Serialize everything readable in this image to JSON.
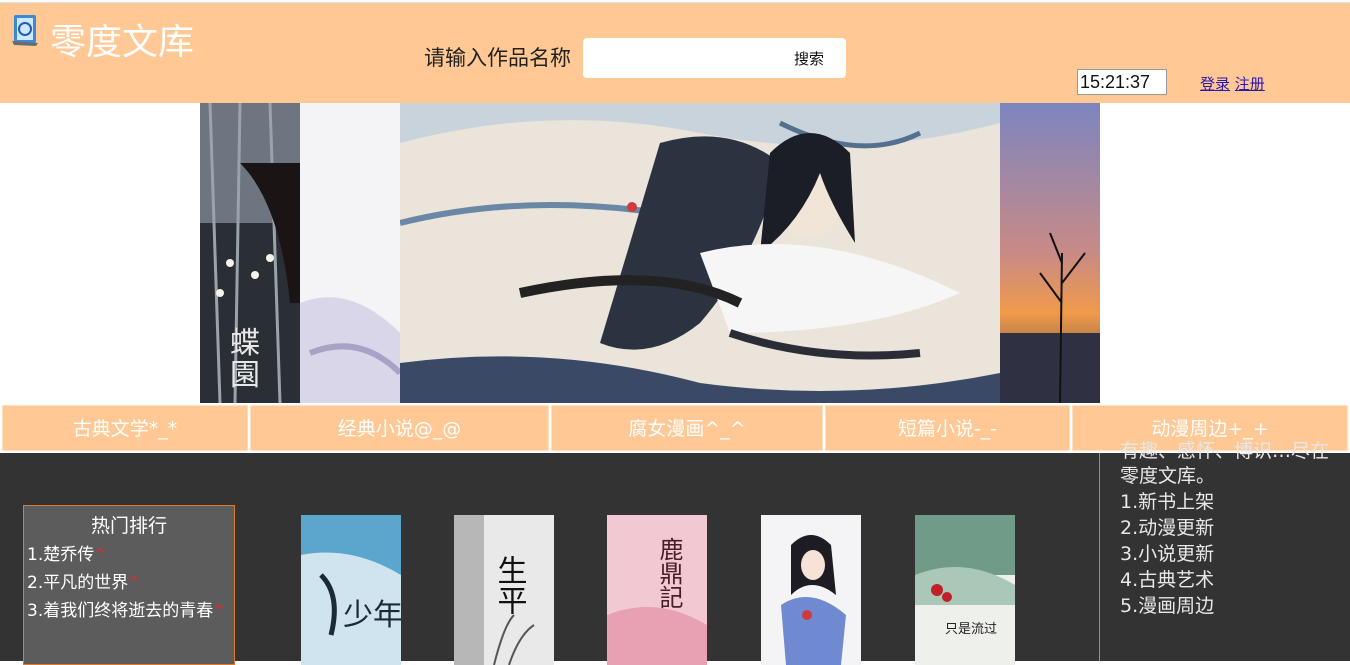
{
  "header": {
    "site_title": "零度文库",
    "search_label": "请输入作品名称",
    "search_placeholder": "",
    "search_button": "搜索",
    "clock": "15:21:37",
    "login": "登录",
    "register": "注册"
  },
  "nav": {
    "items": [
      "古典文学*_*",
      "经典小说@_@",
      "腐女漫画^_^",
      "短篇小说-_-",
      "动漫周边+_+"
    ]
  },
  "hot": {
    "title": "热门排行",
    "items": [
      "1.楚乔传",
      "2.平凡的世界",
      "3.着我们终将逝去的青春"
    ],
    "mark": "^"
  },
  "sidebar": {
    "cut_text": "有趣、感怀、博识…尽在",
    "intro": "零度文库。",
    "items": [
      "1.新书上架",
      "2.动漫更新",
      "3.小说更新",
      "4.古典艺术",
      "5.漫画周边"
    ]
  },
  "banner": {
    "left_caption": "蝶园"
  },
  "books": {
    "titles": [
      "少年",
      "生平",
      "鹿鼎記",
      "",
      "只是流过"
    ]
  },
  "colors": {
    "header_bg": "#ffc894",
    "content_bg": "#333333",
    "accent_border": "#e07a2a"
  }
}
